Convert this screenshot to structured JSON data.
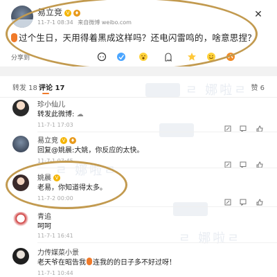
{
  "post": {
    "author": "易立竞",
    "time": "11-7-1 08:34",
    "source": "来自微博 weibo.com",
    "text": "过个生日，天用得着黑成这样吗？还电闪雷鸣的，啥意思捏？",
    "share_label": "分享到",
    "share_icons": [
      "comment-icon",
      "like-icon",
      "wow-icon",
      "ghost-icon",
      "star-icon",
      "smile-icon",
      "share-icon"
    ]
  },
  "tabs": {
    "repost": "转发 18",
    "comment": "评论 17",
    "like": "赞 6"
  },
  "comments": [
    {
      "name": "珍小仙儿",
      "text": "转发此微博:",
      "time": "11-7-1 17:03"
    },
    {
      "name": "易立竞",
      "text": "回复@姚晨:大姚，你反应的太快。",
      "time": "11-7-1 07:45"
    },
    {
      "name": "姚晨",
      "text": "老易，你知道得太多。",
      "time": "11-7-2 00:00"
    },
    {
      "name": "青追",
      "text": "呵呵",
      "time": "11-7-1 16:41"
    },
    {
      "name": "力传媒菜小景",
      "text": "老天爷在昭告我",
      "text_tail": "连我的的日子多不好过呀！",
      "time": "11-7-1 10:44"
    }
  ],
  "colors": {
    "accent": "#f07a2a",
    "highlight": "#c29a4f",
    "vip": "#f4b400"
  }
}
